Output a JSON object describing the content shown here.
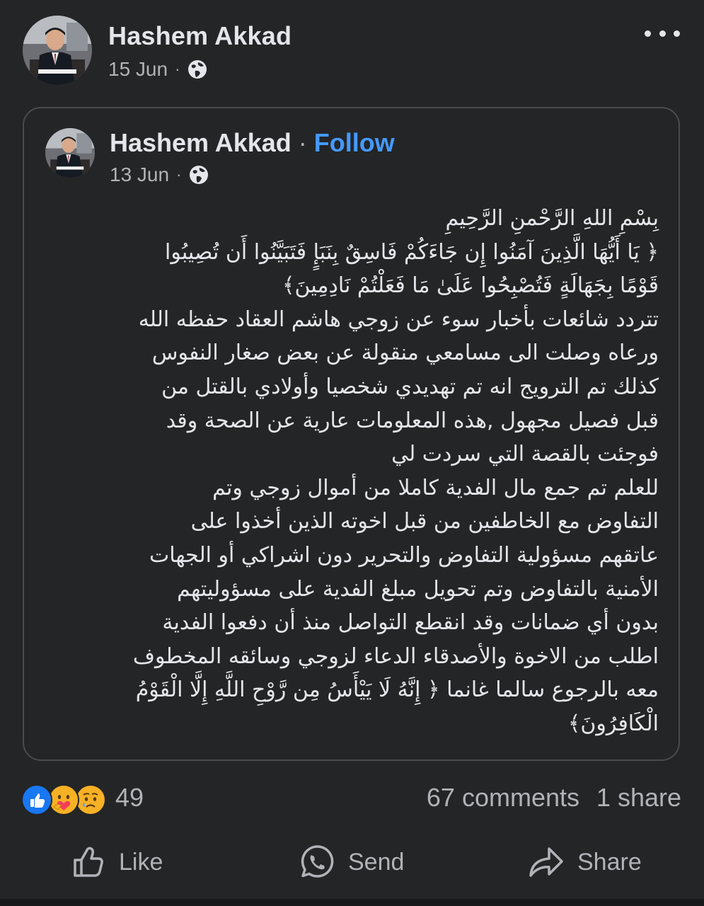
{
  "post": {
    "author": "Hashem Akkad",
    "date": "15 Jun",
    "separator": "·",
    "audience_icon": "globe-icon",
    "more_icon": "more-options-icon"
  },
  "shared_post": {
    "author": "Hashem Akkad",
    "separator": "·",
    "follow_label": "Follow",
    "date": "13 Jun",
    "audience_icon": "globe-icon",
    "text_lines": [
      "بِسْمِ اللهِ الرَّحْمنِ الرَّحِيمِ",
      "﴿ يَا أَيُّهَا الَّذِينَ آمَنُوا إِن جَاءَكُمْ فَاسِقٌ بِنَبَإٍ فَتَبَيَّنُوا أَن تُصِيبُوا",
      "قَوْمًا بِجَهَالَةٍ فَتُصْبِحُوا عَلَىٰ مَا فَعَلْتُمْ نَادِمِينَ﴾",
      "تتردد شائعات بأخبار سوء عن زوجي هاشم العقاد حفظه الله",
      "ورعاه وصلت الى مسامعي منقولة عن بعض صغار النفوس",
      "كذلك تم الترويج انه تم تهديدي شخصيا وأولادي بالقتل من",
      "قبل فصيل مجهول ,هذه المعلومات عارية عن الصحة وقد",
      "فوجئت بالقصة التي سردت لي",
      "للعلم تم جمع مال الفدية كاملا من أموال زوجي وتم",
      "التفاوض مع الخاطفين من قبل اخوته الذين أخذوا على",
      "عاتقهم مسؤولية التفاوض والتحرير دون اشراكي أو الجهات",
      "الأمنية بالتفاوض وتم تحويل مبلغ الفدية على مسؤوليتهم",
      "بدون أي ضمانات وقد انقطع التواصل منذ أن دفعوا الفدية",
      "اطلب من الاخوة والأصدقاء الدعاء لزوجي وسائقه المخطوف",
      "معه بالرجوع سالما غانما ﴿ إِنَّهُ لَا يَيْأَسُ مِن رَّوْحِ اللَّهِ إِلَّا الْقَوْمُ",
      "الْكَافِرُونَ﴾"
    ]
  },
  "engagement": {
    "reactions": [
      "like-icon",
      "care-icon",
      "sad-icon"
    ],
    "reaction_count": "49",
    "comments": "67 comments",
    "shares": "1 share"
  },
  "actions": {
    "like": "Like",
    "send": "Send",
    "share": "Share"
  },
  "colors": {
    "background": "#242526",
    "text": "#e4e6eb",
    "secondary_text": "#b0b3b8",
    "link": "#4599ff",
    "card_border": "#4a4b4d"
  }
}
